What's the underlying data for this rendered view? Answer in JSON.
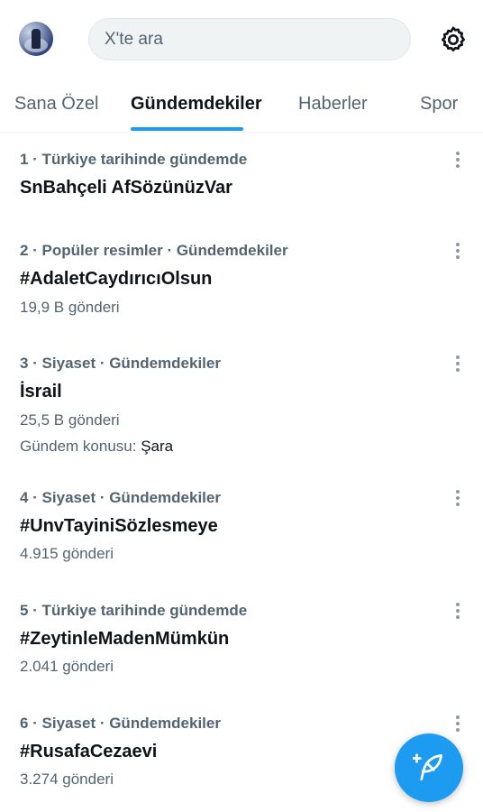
{
  "header": {
    "search_placeholder": "X'te ara",
    "avatar_icon": "profile-avatar",
    "settings_icon": "gear-icon"
  },
  "tabs": [
    {
      "label": "Sana Özel",
      "active": false
    },
    {
      "label": "Gündemdekiler",
      "active": true
    },
    {
      "label": "Haberler",
      "active": false
    },
    {
      "label": "Spor",
      "active": false
    }
  ],
  "trends": [
    {
      "meta": "1 · Türkiye tarihinde gündemde",
      "name": "SnBahçeli AfSözünüzVar",
      "count": "",
      "topic_label": "",
      "topic_value": ""
    },
    {
      "meta": "2 · Popüler resimler · Gündemdekiler",
      "name": "#AdaletCaydırıcıOlsun",
      "count": "19,9 B gönderi",
      "topic_label": "",
      "topic_value": ""
    },
    {
      "meta": "3 · Siyaset · Gündemdekiler",
      "name": "İsrail",
      "count": "25,5 B gönderi",
      "topic_label": "Gündem konusu: ",
      "topic_value": "Şara"
    },
    {
      "meta": "4 · Siyaset · Gündemdekiler",
      "name": "#UnvTayiniSözlesmeye",
      "count": "4.915 gönderi",
      "topic_label": "",
      "topic_value": ""
    },
    {
      "meta": "5 · Türkiye tarihinde gündemde",
      "name": "#ZeytinleMadenMümkün",
      "count": "2.041 gönderi",
      "topic_label": "",
      "topic_value": ""
    },
    {
      "meta": "6 · Siyaset · Gündemdekiler",
      "name": "#RusafaCezaevi",
      "count": "3.274 gönderi",
      "topic_label": "",
      "topic_value": ""
    }
  ],
  "fab": {
    "icon": "compose-post-icon"
  },
  "colors": {
    "accent": "#1d9bf0",
    "secondary_text": "#536471",
    "primary_text": "#0f1419"
  }
}
